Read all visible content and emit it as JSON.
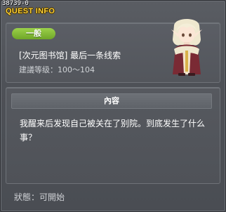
{
  "window": {
    "quest_id": "38739-0",
    "title": "QUEST INFO"
  },
  "quest": {
    "category_badge": "一般",
    "name": "[次元图书馆] 最后一条线索",
    "level_label": "建議等级：",
    "level_range": "100～104"
  },
  "content": {
    "header": "內容",
    "body": "我醒来后发现自己被关在了别院。到底发生了什么事？"
  },
  "status": {
    "label": "狀態：",
    "value": "可開始"
  },
  "colors": {
    "title": "#ffd23a",
    "badge": "#8cc63f",
    "background": "#4e5157"
  },
  "icons": {
    "npc": "elf-npc-portrait"
  }
}
